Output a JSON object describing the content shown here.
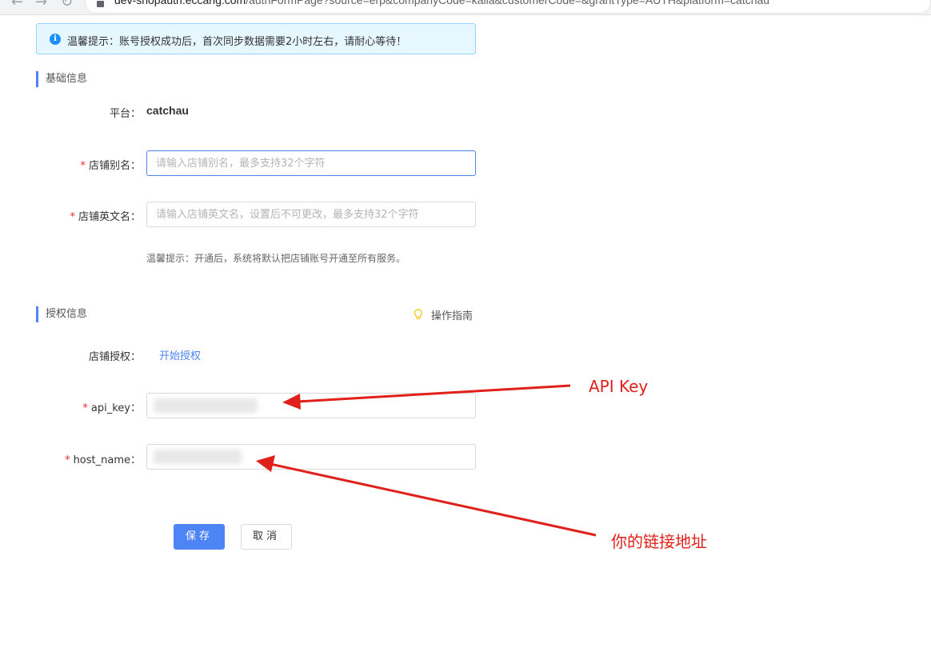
{
  "browser": {
    "url_host": "dev-shopauth.eccang.com",
    "url_path": "/authFormPage?source=erp&companyCode=kalla&customerCode=&grantType=AUTH&platform=catchau"
  },
  "alert": {
    "text": "温馨提示：账号授权成功后，首次同步数据需要2小时左右，请耐心等待！"
  },
  "basic_section": {
    "title": "基础信息",
    "platform_label": "平台：",
    "platform_value": "catchau",
    "alias_label": "店铺别名：",
    "alias_placeholder": "请输入店铺别名，最多支持32个字符",
    "english_label": "店铺英文名：",
    "english_placeholder": "请输入店铺英文名，设置后不可更改，最多支持32个字符",
    "hint": "温馨提示：开通后，系统将默认把店铺账号开通至所有服务。",
    "required_mark": "*"
  },
  "auth_section": {
    "title": "授权信息",
    "guide_label": "操作指南",
    "shop_auth_label": "店铺授权：",
    "shop_auth_link": "开始授权",
    "api_key_label": "api_key：",
    "host_name_label": "host_name：",
    "required_mark": "*"
  },
  "actions": {
    "save_label": "保存",
    "cancel_label": "取消"
  },
  "annotations": {
    "api_key_note": "API Key",
    "host_note": "你的链接地址",
    "color": "#e0201a"
  },
  "colors": {
    "accent": "#4d84f6",
    "alert_bg": "#e6f7ff",
    "alert_border": "#91d5ff",
    "required": "#f5222d"
  }
}
